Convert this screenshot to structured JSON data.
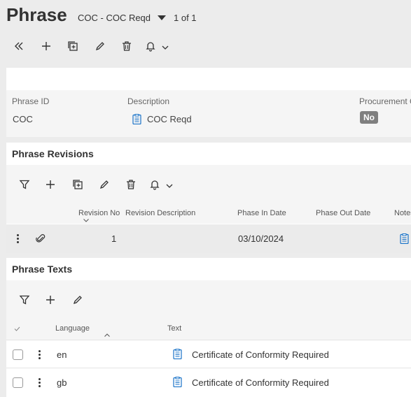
{
  "header": {
    "title": "Phrase",
    "record_selector": "COC - COC Reqd",
    "record_count": "1 of 1"
  },
  "toolbar_icons": [
    "double-chevron-left-icon",
    "plus-icon",
    "duplicate-icon",
    "pencil-icon",
    "trash-icon",
    "bell-icon",
    "chevron-down-icon"
  ],
  "detail": {
    "fields": {
      "phrase_id_label": "Phrase ID",
      "phrase_id_value": "COC",
      "description_label": "Description",
      "description_value": "COC Reqd",
      "procurement_label": "Procurement C",
      "procurement_value": "No"
    }
  },
  "revisions": {
    "title": "Phrase Revisions",
    "columns": {
      "revision_no": "Revision No",
      "revision_description": "Revision Description",
      "phase_in": "Phase In Date",
      "phase_out": "Phase Out Date",
      "notes": "Notes"
    },
    "rows": [
      {
        "revision_no": "1",
        "revision_description": "",
        "phase_in": "03/10/2024",
        "phase_out": ""
      }
    ]
  },
  "texts": {
    "title": "Phrase Texts",
    "columns": {
      "language": "Language",
      "text": "Text"
    },
    "rows": [
      {
        "language": "en",
        "text": "Certificate of Conformity Required"
      },
      {
        "language": "gb",
        "text": "Certificate of Conformity Required"
      }
    ]
  },
  "colors": {
    "accent_icon": "#1a73c8",
    "badge_bg": "#7f7f7f",
    "row_selected": "#ebebeb"
  }
}
